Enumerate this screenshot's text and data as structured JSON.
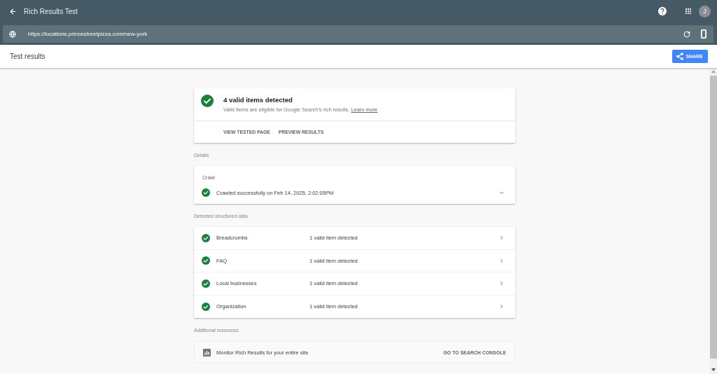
{
  "app_bar": {
    "title": "Rich Results Test",
    "avatar_initial": "J"
  },
  "url_bar": {
    "value": "https://locations.princestreetpizza.com/new-york"
  },
  "results_bar": {
    "title": "Test results",
    "share_label": "SHARE"
  },
  "summary": {
    "kind": "valid",
    "title": "4 valid items detected",
    "description": "Valid items are eligible for Google Search's rich results.",
    "link": "Learn more",
    "actions": [
      "VIEW TESTED PAGE",
      "PREVIEW RESULTS"
    ]
  },
  "details": {
    "heading": "Details",
    "section_label": "Crawl",
    "kind": "valid",
    "message": "Crawled successfully on Feb 14, 2025, 2:02:05PM",
    "expanded": false
  },
  "structured_data": {
    "heading": "Detected structured data",
    "rows": [
      {
        "kind": "valid",
        "name": "Breadcrumbs",
        "result": "1 valid item detected"
      },
      {
        "kind": "valid",
        "name": "FAQ",
        "result": "1 valid item detected"
      },
      {
        "kind": "valid",
        "name": "Local businesses",
        "result": "1 valid item detected"
      },
      {
        "kind": "valid",
        "name": "Organization",
        "result": "1 valid item detected"
      }
    ]
  },
  "additional_resources": {
    "heading": "Additional resources",
    "items": [
      {
        "label": "Monitor Rich Results for your entire site",
        "action": "GO TO SEARCH CONSOLE"
      }
    ]
  }
}
